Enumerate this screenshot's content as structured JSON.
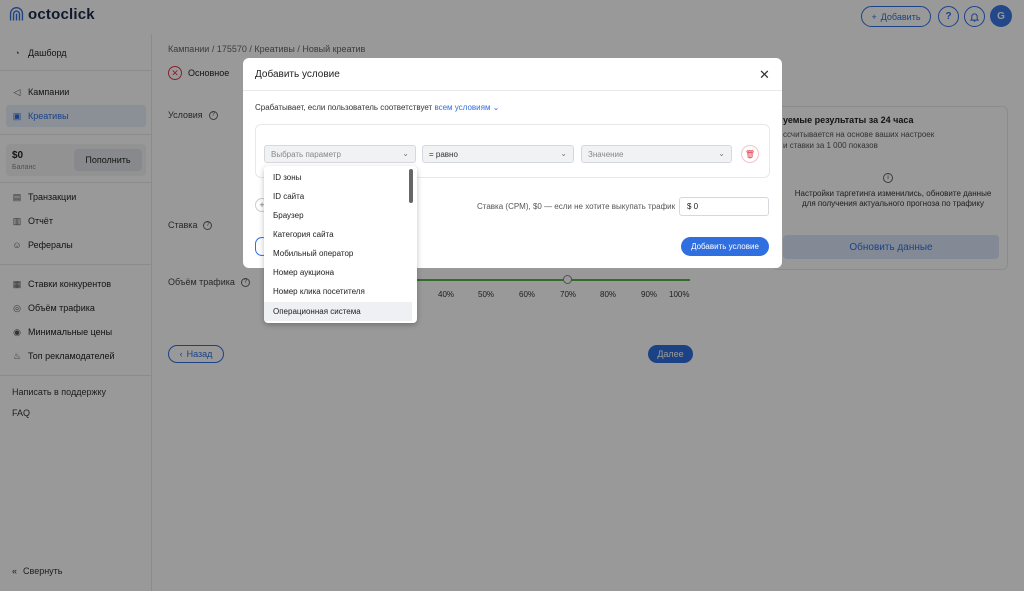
{
  "app": {
    "logo_text": "octoclick"
  },
  "topbar": {
    "add_label": "Добавить",
    "add_icon": "plus-icon",
    "help_icon": "question-icon",
    "bell_icon": "bell-icon",
    "avatar_letter": "G"
  },
  "sidebar": {
    "items": [
      {
        "label": "Дашборд",
        "icon": "dashboard-icon"
      },
      {
        "label": "Кампании",
        "icon": "megaphone-icon"
      },
      {
        "label": "Креативы",
        "icon": "image-icon"
      },
      {
        "label": "Транзакции",
        "icon": "card-icon"
      },
      {
        "label": "Отчёт",
        "icon": "report-icon"
      },
      {
        "label": "Рефералы",
        "icon": "users-icon"
      },
      {
        "label": "Ставки конкурентов",
        "icon": "table-icon"
      },
      {
        "label": "Объём трафика",
        "icon": "gauge-icon"
      },
      {
        "label": "Минимальные цены",
        "icon": "coin-icon"
      },
      {
        "label": "Топ рекламодателей",
        "icon": "flame-icon"
      }
    ],
    "balance_amount": "$0",
    "balance_label": "Баланс",
    "topup_label": "Пополнить",
    "support_label": "Написать в поддержку",
    "faq_label": "FAQ",
    "collapse_label": "Свернуть"
  },
  "main": {
    "breadcrumb": "Кампании  /  175570  /  Креативы  /  Новый креатив",
    "step_label": "Основное",
    "conditions_label": "Условия",
    "bid_label": "Ставка",
    "traffic_label": "Объём трафика",
    "scale": [
      "40%",
      "50%",
      "60%",
      "70%",
      "80%",
      "90%",
      "100%"
    ],
    "back_label": "Назад",
    "next_label": "Далее"
  },
  "forecast": {
    "title": "уемые результаты за 24 часа",
    "sub_line1": "ссчитывается на основе ваших настроек",
    "sub_line2": "и ставки за 1 000 показов",
    "message": "Настройки таргетинга изменились, обновите данные для получения актуального прогноза по трафику",
    "refresh_label": "Обновить данные"
  },
  "modal": {
    "title": "Добавить условие",
    "trigger_text": "Срабатывает, если пользователь соответствует",
    "trigger_link": "всем условиям",
    "param_placeholder": "Выбрать параметр",
    "operator_value": "= равно",
    "value_placeholder": "Значение",
    "rate_label": "Ставка (CPM), $0 — если не хотите выкупать трафик",
    "rate_value": "$ 0",
    "add_label": "Добавить условие"
  },
  "dropdown": {
    "options": [
      "ID зоны",
      "ID сайта",
      "Браузер",
      "Категория сайта",
      "Мобильный оператор",
      "Номер аукциона",
      "Номер клика посетителя",
      "Операционная система"
    ],
    "highlighted": "Операционная система"
  },
  "colors": {
    "accent": "#2f6fe0",
    "danger": "#e0384b",
    "overlay": "rgba(0,0,0,0.4)"
  }
}
